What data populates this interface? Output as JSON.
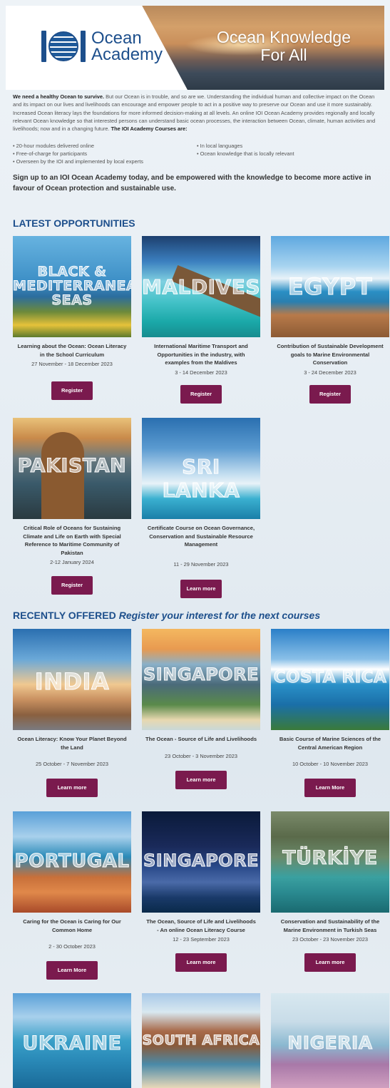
{
  "header": {
    "logo_line1": "Ocean",
    "logo_line2": "Academy",
    "tagline_line1": "Ocean Knowledge",
    "tagline_line2": "For All"
  },
  "intro": {
    "lead": "We need a healthy Ocean to survive.",
    "body": "But our Ocean is in trouble, and so are we. Understanding the individual human and collective impact on the Ocean and its impact on our lives and livelihoods can encourage and empower people to act in a positive way to preserve our Ocean and use it more sustainably. Increased Ocean literacy lays the foundations for more informed decision-making at all levels. An online IOI Ocean Academy provides regionally and locally relevant Ocean knowledge so that interested persons can understand basic ocean processes, the interaction between Ocean, climate, human activities and livelihoods; now and in a changing future.",
    "courses_heading": "The IOI Academy Courses are:",
    "bullets_left": [
      "20-hour modules delivered online",
      "Free-of-charge for participants",
      "Overseen by the IOI and implemented by local experts"
    ],
    "bullets_right": [
      "In local languages",
      "Ocean knowledge that is locally relevant"
    ],
    "signup": "Sign up to an IOI Ocean Academy today, and be empowered with the knowledge to become more active in favour of Ocean protection and sustainable use."
  },
  "latest": {
    "title": "LATEST OPPORTUNITIES",
    "cards": [
      {
        "label": "BLACK & MEDITERRANEAN SEAS",
        "title": "Learning about the Ocean: Ocean Literacy in the School Curriculum",
        "date": "27 November - 18 December 2023",
        "button": "Register"
      },
      {
        "label": "MALDIVES",
        "title": "International Maritime Transport and Opportunities in the industry, with examples from the Maldives",
        "date": "3 - 14 December 2023",
        "button": "Register"
      },
      {
        "label": "EGYPT",
        "title": "Contribution of Sustainable Development goals to Marine Environmental Conservation",
        "date": "3 - 24 December 2023",
        "button": "Register"
      },
      {
        "label": "PAKISTAN",
        "title": "Critical Role of Oceans for Sustaining Climate and Life on Earth with Special Reference to Maritime Community of Pakistan",
        "date": "2-12 January 2024",
        "button": "Register"
      },
      {
        "label": "SRI LANKA",
        "title": "Certificate Course on Ocean Governance, Conservation and Sustainable Resource Management",
        "date": "11 - 29 November 2023",
        "button": "Learn more"
      }
    ]
  },
  "recent": {
    "title": "RECENTLY OFFERED",
    "subtitle": "Register your interest for the next courses",
    "cards": [
      {
        "label": "INDIA",
        "title": "Ocean Literacy: Know Your Planet Beyond the Land",
        "date": "25 October - 7 November 2023",
        "button": "Learn more"
      },
      {
        "label": "SINGAPORE",
        "title": "The Ocean - Source of Life and Livelihoods",
        "date": "23 October - 3 November 2023",
        "button": "Learn more"
      },
      {
        "label": "COSTA RICA",
        "title": "Basic Course of Marine Sciences of the Central American Region",
        "date": "10 October - 10 November 2023",
        "button": "Learn More"
      },
      {
        "label": "PORTUGAL",
        "title": "Caring for the Ocean is Caring for Our Common Home",
        "date": "2 - 30 October 2023",
        "button": "Learn More"
      },
      {
        "label": "SINGAPORE",
        "title": "The Ocean, Source of Life and Livelihoods - An online Ocean Literacy Course",
        "date": "12 - 23 September 2023",
        "button": "Learn more"
      },
      {
        "label": "TÜRKİYE",
        "title": "Conservation and Sustainability of the Marine Environment in Turkish Seas",
        "date": "23 October - 23 November 2023",
        "button": "Learn more"
      },
      {
        "label": "UKRAINE"
      },
      {
        "label": "SOUTH AFRICA"
      },
      {
        "label": "NIGERIA"
      }
    ]
  },
  "colors": {
    "accent": "#1d4f8c",
    "button": "#7a1a4e"
  }
}
